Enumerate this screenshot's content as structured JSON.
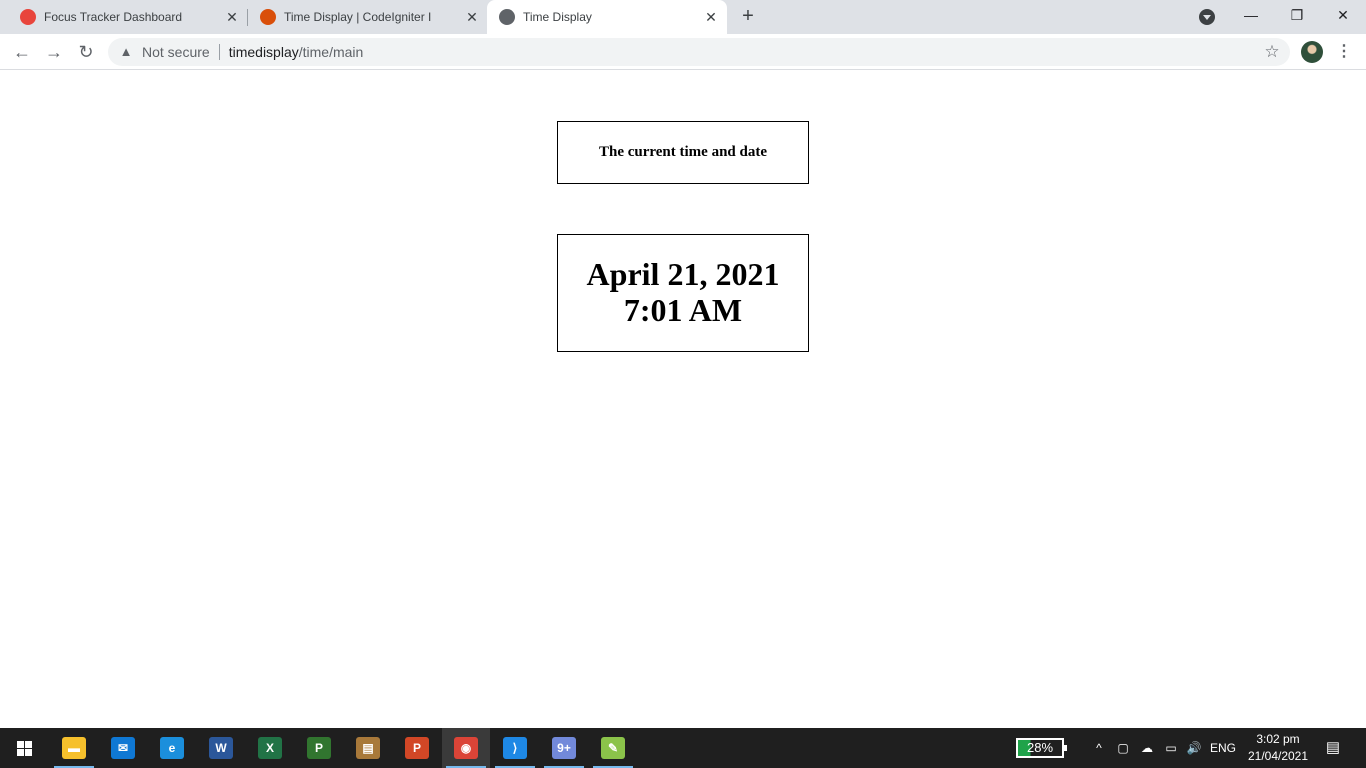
{
  "browser": {
    "tabs": [
      {
        "title": "Focus Tracker Dashboard",
        "favicon_color": "#e8453c"
      },
      {
        "title": "Time Display | CodeIgniter I",
        "favicon_color": "#d94f0a"
      },
      {
        "title": "Time Display",
        "favicon_color": "#5f6368"
      }
    ],
    "new_tab_icon": "+",
    "window_controls": {
      "minimize": "—",
      "restore": "❐",
      "close": "✕"
    },
    "toolbar": {
      "back_icon": "←",
      "forward_icon": "→",
      "reload_icon": "↻",
      "security_icon": "▲",
      "security_text": "Not secure",
      "url_host": "timedisplay",
      "url_path": "/time/main",
      "bookmark_icon": "☆",
      "menu_icon": "⋮"
    }
  },
  "page": {
    "heading": "The current time and date",
    "date": "April 21, 2021",
    "time": "7:01 AM"
  },
  "taskbar": {
    "apps": [
      {
        "name": "file-explorer",
        "label": "▬",
        "color": "#f6c02c"
      },
      {
        "name": "mail",
        "label": "✉",
        "color": "#0f78d4"
      },
      {
        "name": "edge",
        "label": "e",
        "color": "#1b8fdc"
      },
      {
        "name": "word",
        "label": "W",
        "color": "#2b579a"
      },
      {
        "name": "excel",
        "label": "X",
        "color": "#217346"
      },
      {
        "name": "project",
        "label": "P",
        "color": "#31752f"
      },
      {
        "name": "book",
        "label": "▤",
        "color": "#a8793a"
      },
      {
        "name": "powerpoint",
        "label": "P",
        "color": "#d24726"
      },
      {
        "name": "chrome",
        "label": "◉",
        "color": "#db4437"
      },
      {
        "name": "vscode",
        "label": "⟩",
        "color": "#1e88e5"
      },
      {
        "name": "discord",
        "label": "9+",
        "color": "#7289da"
      },
      {
        "name": "paint",
        "label": "✎",
        "color": "#8bc34a"
      }
    ],
    "battery_percent": "28%",
    "tray": {
      "chevron": "^",
      "language": "ENG"
    },
    "clock": {
      "time": "3:02 pm",
      "date": "21/04/2021"
    },
    "notification_icon": "▤"
  }
}
